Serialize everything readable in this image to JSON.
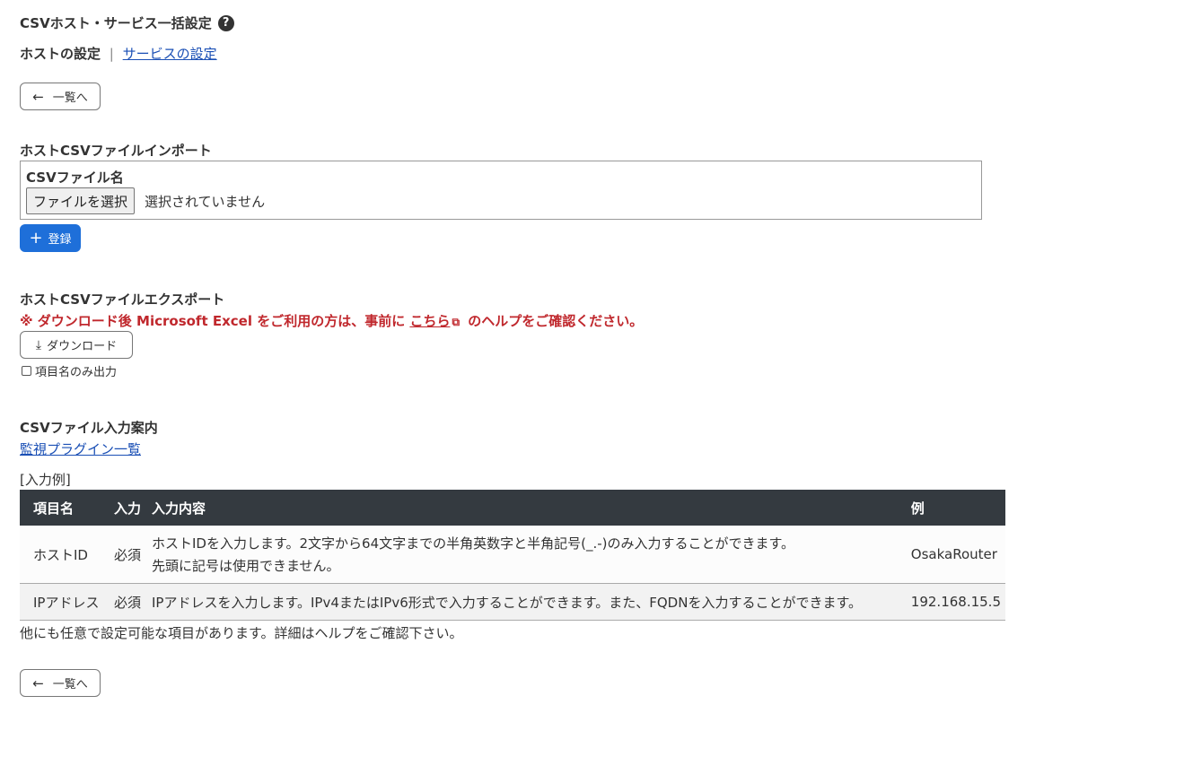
{
  "page": {
    "title": "CSVホスト・サービス一括設定",
    "help_icon": "?"
  },
  "tabs": {
    "active": "ホストの設定",
    "separator": "|",
    "link": "サービスの設定"
  },
  "back_button": {
    "label": "一覧へ",
    "icon": "←"
  },
  "import": {
    "heading": "ホストCSVファイルインポート",
    "field_label": "CSVファイル名",
    "file_button": "ファイルを選択",
    "file_status": "選択されていません",
    "register_icon": "+",
    "register_label": "登録"
  },
  "export": {
    "heading": "ホストCSVファイルエクスポート",
    "warning_prefix": "※ ダウンロード後 Microsoft Excel をご利用の方は、事前に",
    "warning_link": "こちら",
    "warning_suffix": "のヘルプをご確認ください。",
    "external_icon": "⧉",
    "download_icon": "⤓",
    "download_label": "ダウンロード",
    "checkbox_label": "項目名のみ出力"
  },
  "guide": {
    "heading": "CSVファイル入力案内",
    "plugin_link": "監視プラグイン一覧",
    "example_label": "[入力例]",
    "columns": [
      "項目名",
      "入力",
      "入力内容",
      "例"
    ],
    "rows": [
      {
        "name": "ホストID",
        "required": "必須",
        "desc_line1": "ホストIDを入力します。2文字から64文字までの半角英数字と半角記号(_.-)のみ入力することができます。",
        "desc_line2": "先頭に記号は使用できません。",
        "example": "OsakaRouter"
      },
      {
        "name": "IPアドレス",
        "required": "必須",
        "desc_line1": "IPアドレスを入力します。IPv4またはIPv6形式で入力することができます。また、FQDNを入力することができます。",
        "example": "192.168.15.5"
      }
    ],
    "note": "他にも任意で設定可能な項目があります。詳細はヘルプをご確認下さい。"
  },
  "colors": {
    "primary": "#1e6fd9",
    "warning": "#c0282d",
    "table_header": "#343a40",
    "link": "#1a4fb5"
  }
}
